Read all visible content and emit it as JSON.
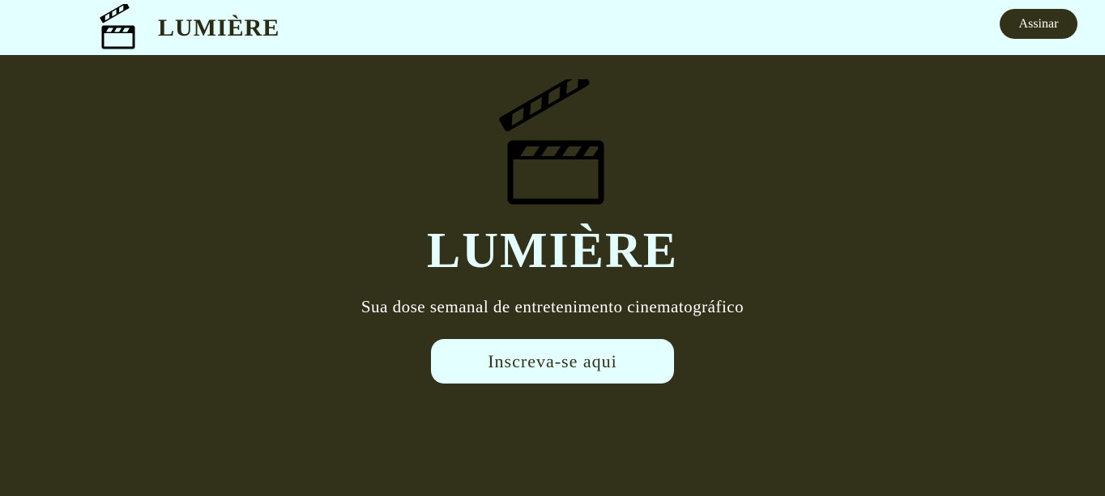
{
  "header": {
    "brand": "LUMIÈRE",
    "logo_icon": "clapperboard-icon",
    "subscribe_label": "Assinar"
  },
  "hero": {
    "logo_icon": "clapperboard-icon",
    "title": "LUMIÈRE",
    "subtitle": "Sua dose semanal de entretenimento cinematográfico",
    "cta_label": "Inscreva-se aqui"
  },
  "colors": {
    "header_background": "#e4ffff",
    "hero_background": "#32311a",
    "accent_light": "#e4ffff",
    "accent_dark": "#32311a"
  }
}
